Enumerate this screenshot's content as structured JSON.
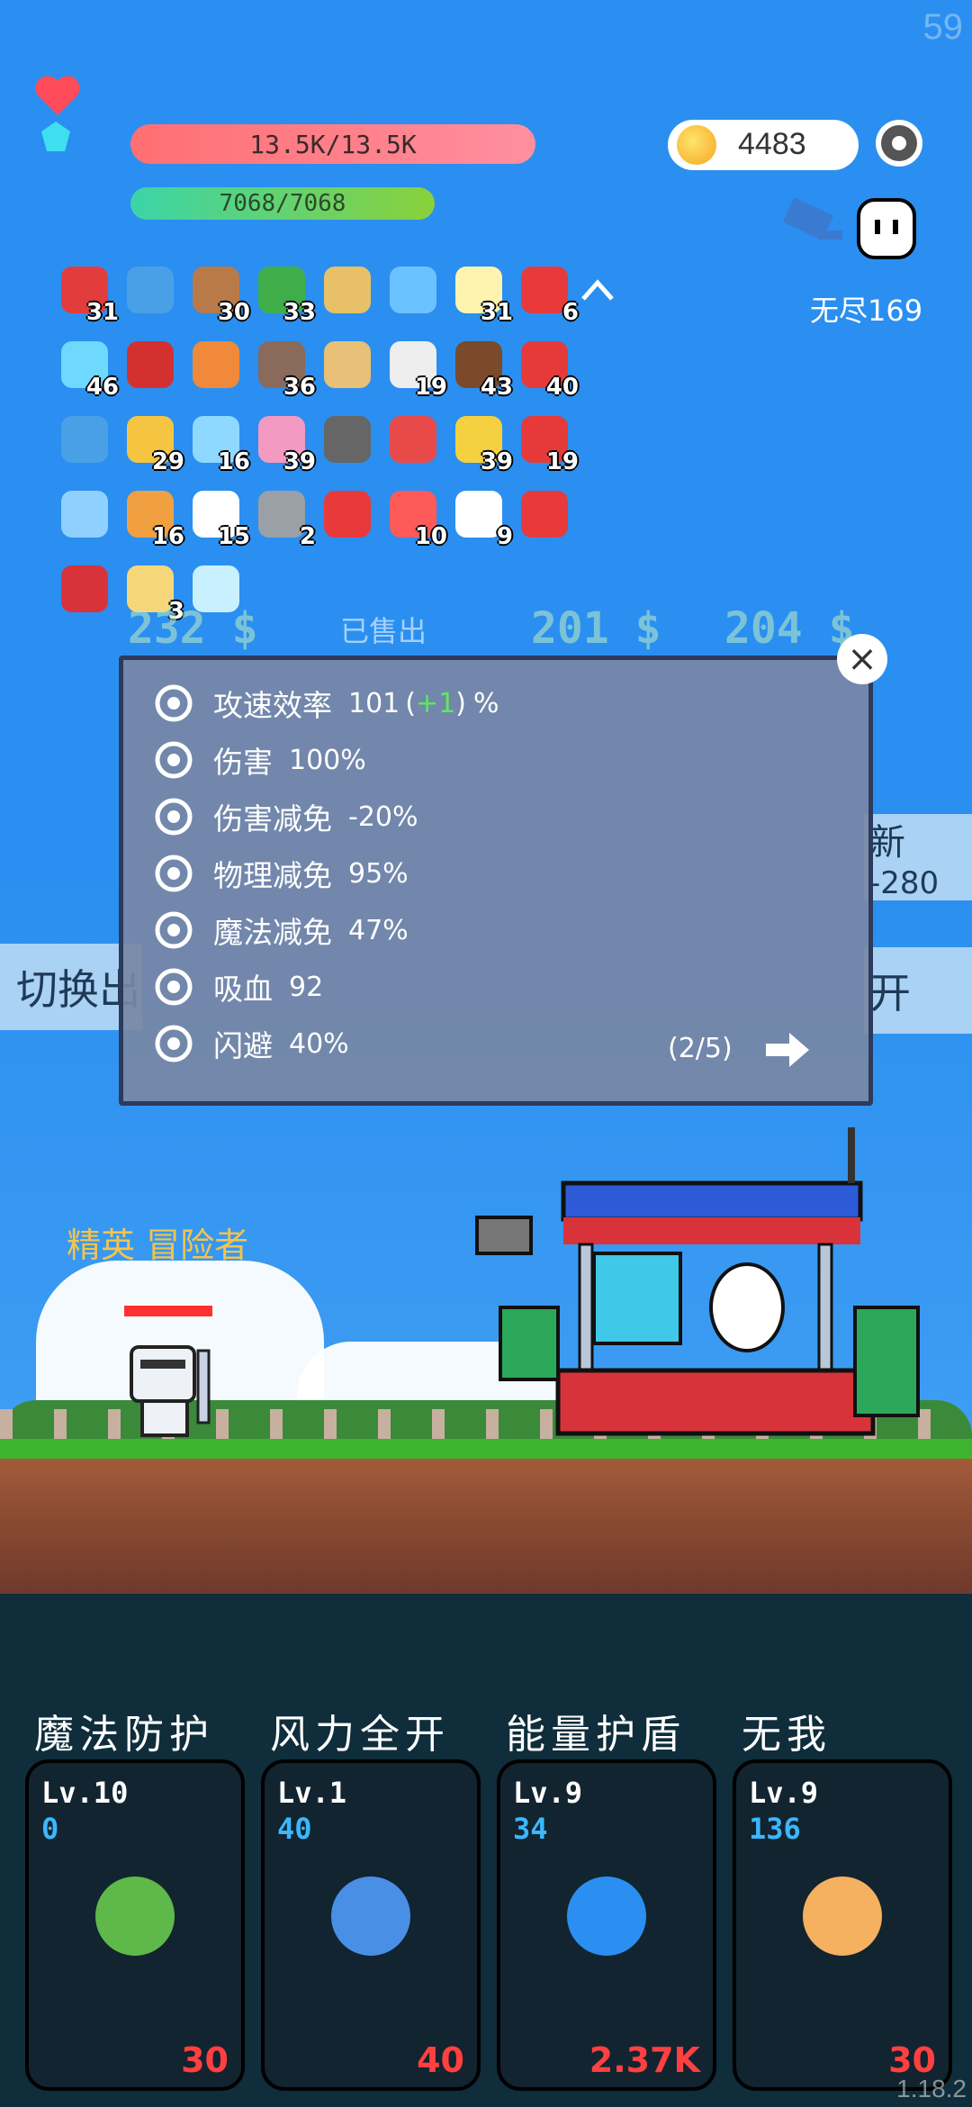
{
  "fps": "59",
  "hp": {
    "text": "13.5K/13.5K"
  },
  "mp": {
    "text": "7068/7068"
  },
  "coins": "4483",
  "mode_label": "无尽169",
  "items": [
    {
      "name": "apple",
      "count": "31",
      "color": "#e23c3c"
    },
    {
      "name": "star-card",
      "count": "",
      "color": "#4aa0e6"
    },
    {
      "name": "shield-round",
      "count": "30",
      "color": "#b97a4a"
    },
    {
      "name": "watermelon",
      "count": "33",
      "color": "#3fae4a"
    },
    {
      "name": "treasure-map",
      "count": "",
      "color": "#e8c067"
    },
    {
      "name": "magnifier",
      "count": "",
      "color": "#6ac3ff"
    },
    {
      "name": "flower",
      "count": "31",
      "color": "#fff3b0"
    },
    {
      "name": "bookmark-red",
      "count": "6",
      "color": "#e83a3a"
    },
    {
      "name": "feather-sword",
      "count": "46",
      "color": "#6fd8ff"
    },
    {
      "name": "magnet",
      "count": "",
      "color": "#d53030"
    },
    {
      "name": "potion",
      "count": "",
      "color": "#f08a3a"
    },
    {
      "name": "tombstone",
      "count": "36",
      "color": "#8a6a5a"
    },
    {
      "name": "scroll",
      "count": "",
      "color": "#e8c077"
    },
    {
      "name": "cards",
      "count": "19",
      "color": "#eeeeee"
    },
    {
      "name": "coconut",
      "count": "43",
      "color": "#7a4a2a"
    },
    {
      "name": "strawberry",
      "count": "40",
      "color": "#e63a3a"
    },
    {
      "name": "shuriken",
      "count": "",
      "color": "#4aa0e6"
    },
    {
      "name": "bees",
      "count": "29",
      "color": "#f5c542"
    },
    {
      "name": "cat-bottle",
      "count": "16",
      "color": "#8fd8ff"
    },
    {
      "name": "ice-cream",
      "count": "39",
      "color": "#f39ac2"
    },
    {
      "name": "mortar",
      "count": "",
      "color": "#666666"
    },
    {
      "name": "thermometer",
      "count": "",
      "color": "#e84a4a"
    },
    {
      "name": "battery",
      "count": "39",
      "color": "#f5d040"
    },
    {
      "name": "sock",
      "count": "19",
      "color": "#e63a3a"
    },
    {
      "name": "ice-cube",
      "count": "",
      "color": "#8fd0ff"
    },
    {
      "name": "book",
      "count": "16",
      "color": "#f0a040"
    },
    {
      "name": "envelope",
      "count": "15",
      "color": "#ffffff"
    },
    {
      "name": "spiked-ball",
      "count": "2",
      "color": "#9aa0a6"
    },
    {
      "name": "map-pin",
      "count": "",
      "color": "#e83a3a"
    },
    {
      "name": "pill",
      "count": "10",
      "color": "#ff5a5a"
    },
    {
      "name": "ghost",
      "count": "9",
      "color": "#ffffff"
    },
    {
      "name": "mushroom",
      "count": "",
      "color": "#e83a3a"
    },
    {
      "name": "red-shield",
      "count": "",
      "color": "#d8333a"
    },
    {
      "name": "note-paper",
      "count": "3",
      "color": "#f5d77a"
    },
    {
      "name": "lamp",
      "count": "",
      "color": "#c8f0ff"
    }
  ],
  "shop": {
    "price1": "232 $",
    "sold": "已售出",
    "price2": "201 $",
    "price3": "204 $"
  },
  "side": {
    "left_btn": "切换出",
    "right_top": "新",
    "right_top_val": "-280",
    "right_mid": "开"
  },
  "stats": [
    {
      "icon": "bullets-icon",
      "label": "攻速效率",
      "value": "101",
      "bonus": "+1",
      "suffix": "%"
    },
    {
      "icon": "axes-icon",
      "label": "伤害",
      "value": "100%",
      "bonus": "",
      "suffix": ""
    },
    {
      "icon": "target-icon",
      "label": "伤害减免",
      "value": "-20%",
      "bonus": "",
      "suffix": ""
    },
    {
      "icon": "shield-icon",
      "label": "物理减免",
      "value": "95%",
      "bonus": "",
      "suffix": ""
    },
    {
      "icon": "heart-shield-icon",
      "label": "魔法减免",
      "value": "47%",
      "bonus": "",
      "suffix": ""
    },
    {
      "icon": "skull-icon",
      "label": "吸血",
      "value": "92",
      "bonus": "",
      "suffix": ""
    },
    {
      "icon": "dodge-icon",
      "label": "闪避",
      "value": "40%",
      "bonus": "",
      "suffix": ""
    }
  ],
  "page": "(2/5)",
  "enemy_label": "精英 冒险者",
  "skills": [
    {
      "name": "魔法防护",
      "lv": "Lv.10",
      "sub": "0",
      "cost": "30",
      "icon": "leaves-icon"
    },
    {
      "name": "风力全开",
      "lv": "Lv.1",
      "sub": "40",
      "cost": "40",
      "icon": "feather-icon"
    },
    {
      "name": "能量护盾",
      "lv": "Lv.9",
      "sub": "34",
      "cost": "2.37K",
      "icon": "refresh-icon"
    },
    {
      "name": "无我",
      "lv": "Lv.9",
      "sub": "136",
      "cost": "30",
      "icon": "eye-hand-icon"
    }
  ],
  "version": "1.18.2"
}
